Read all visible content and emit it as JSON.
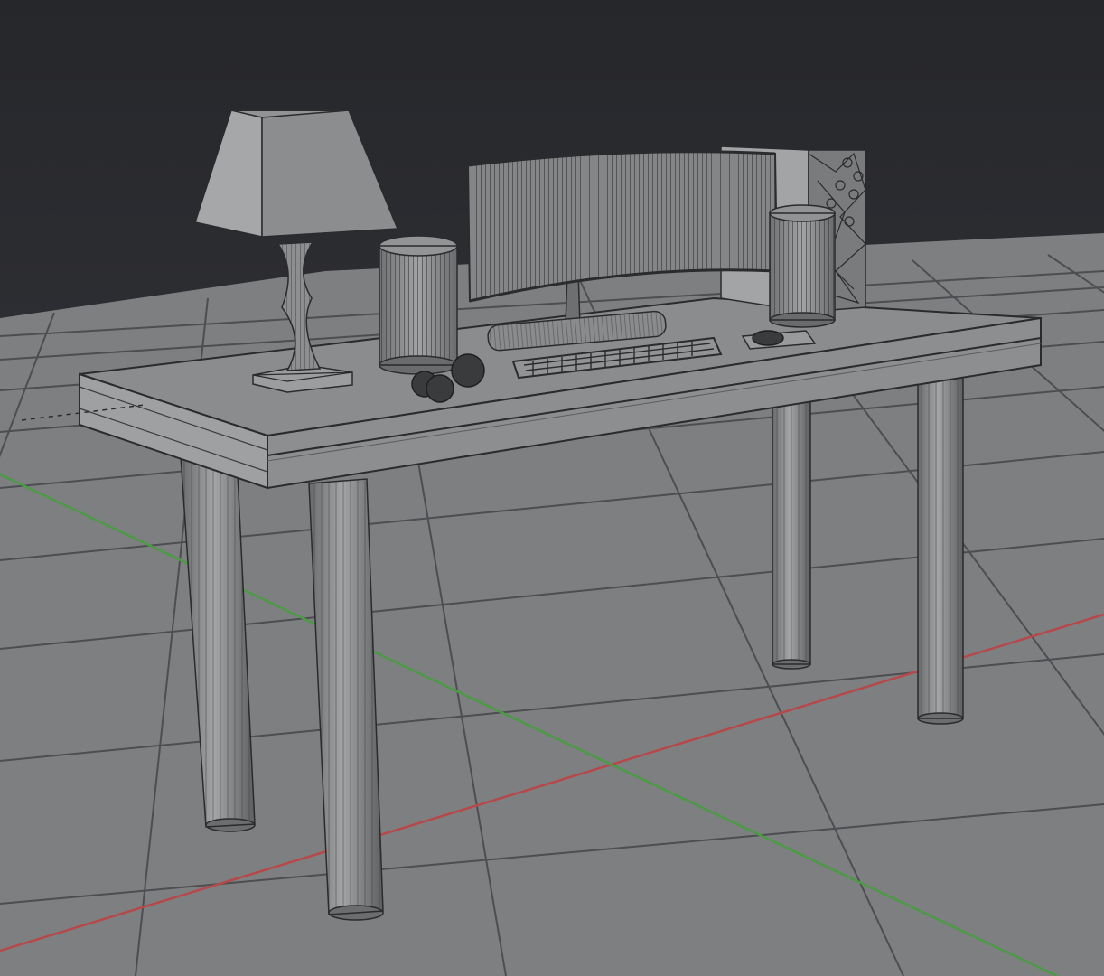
{
  "viewport": {
    "mode": "3D viewport",
    "shading": "solid-with-wireframe",
    "colors": {
      "background_top": "#26272b",
      "background_bottom": "#3a3b40",
      "floor": "#7e7f81",
      "grid_line": "#4d4e51",
      "axis_x": "#b7484a",
      "axis_y": "#4c9a45",
      "mesh_light": "#9d9e9f",
      "mesh_mid": "#858687",
      "mesh_dark": "#5c5d5f",
      "wire": "#2a2b2d"
    }
  },
  "scene": {
    "objects": [
      {
        "name": "desk",
        "icon": "desk-mesh"
      },
      {
        "name": "table-lamp",
        "icon": "lamp-mesh"
      },
      {
        "name": "speaker-left",
        "icon": "cylinder-mesh"
      },
      {
        "name": "speaker-right",
        "icon": "cylinder-mesh"
      },
      {
        "name": "curved-monitor",
        "icon": "monitor-mesh"
      },
      {
        "name": "pc-tower",
        "icon": "box-mesh"
      },
      {
        "name": "keyboard",
        "icon": "keyboard-mesh"
      },
      {
        "name": "mouse",
        "icon": "mouse-mesh"
      },
      {
        "name": "mousepad",
        "icon": "plane-mesh"
      },
      {
        "name": "earbuds",
        "icon": "sphere-mesh"
      }
    ]
  }
}
